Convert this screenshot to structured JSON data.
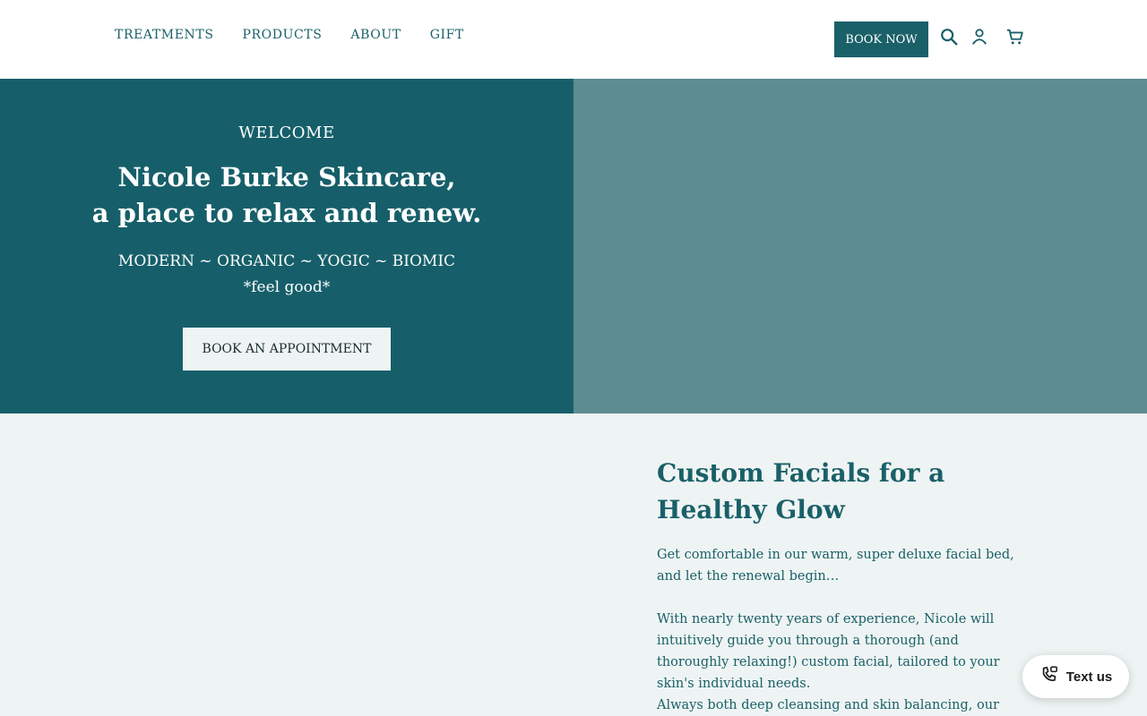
{
  "header": {
    "nav": [
      "TREATMENTS",
      "PRODUCTS",
      "ABOUT",
      "GIFT"
    ],
    "book_now": "BOOK NOW",
    "icons": [
      "search-icon",
      "account-icon",
      "cart-icon"
    ]
  },
  "hero": {
    "eyebrow": "WELCOME",
    "headline_line1": "Nicole Burke Skincare,",
    "headline_line2": "a place to relax and renew.",
    "tagline": "MODERN ~ ORGANIC ~ YOGIC ~ BIOMIC",
    "subtagline": "*feel good*",
    "cta": "BOOK AN APPOINTMENT"
  },
  "section": {
    "title_line1": "Custom Facials for a",
    "title_line2": "Healthy Glow",
    "p1": "Get comfortable in our warm, super deluxe facial bed, and let the renewal begin…",
    "p2": "With nearly twenty years of experience, Nicole will intuitively guide you through a thorough (and thoroughly relaxing!) custom facial, tailored to your skin's individual needs.",
    "p3": "Always both deep cleansing and skin balancing, our facials"
  },
  "chat_widget": {
    "label": "Text us"
  },
  "colors": {
    "brand_teal": "#165f6a",
    "muted_teal": "#5d8c93",
    "background": "#eef4f3"
  }
}
